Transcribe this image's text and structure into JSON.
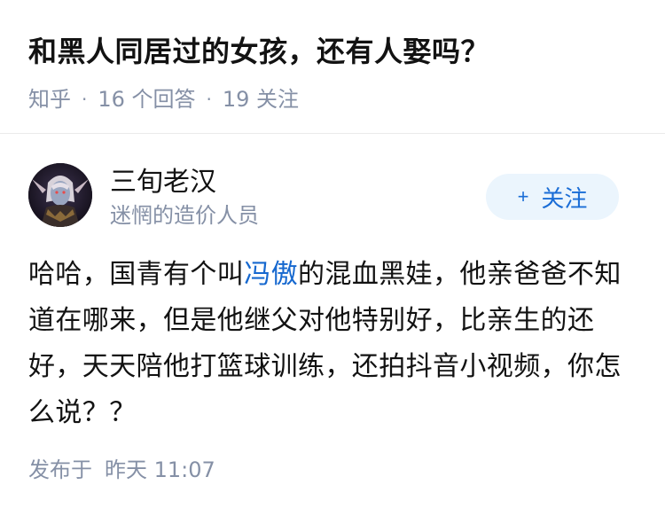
{
  "question": {
    "title": "和黑人同居过的女孩，还有人娶吗？",
    "source": "知乎",
    "answers": "16 个回答",
    "followers": "19 关注",
    "separator": "·"
  },
  "author": {
    "name": "三旬老汉",
    "bio": "迷惘的造价人员",
    "follow_plus": "+",
    "follow_label": "关注",
    "avatar_icon": "avatar-portrait-icon"
  },
  "answer": {
    "text_before_link": "哈哈，国青有个叫",
    "link_text": "冯傲",
    "text_after_link": "的混血黑娃，他亲爸爸不知道在哪来，但是他继父对他特别好，比亲生的还好，天天陪他打篮球训练，还拍抖音小视频，你怎么说？？"
  },
  "footer": {
    "published_label": "发布于",
    "published_time": "昨天 11:07"
  },
  "colors": {
    "title": "#121212",
    "meta": "#8590a6",
    "link": "#1668cf",
    "follow_bg": "#ebf5fd",
    "follow_text": "#1a6dd6"
  }
}
